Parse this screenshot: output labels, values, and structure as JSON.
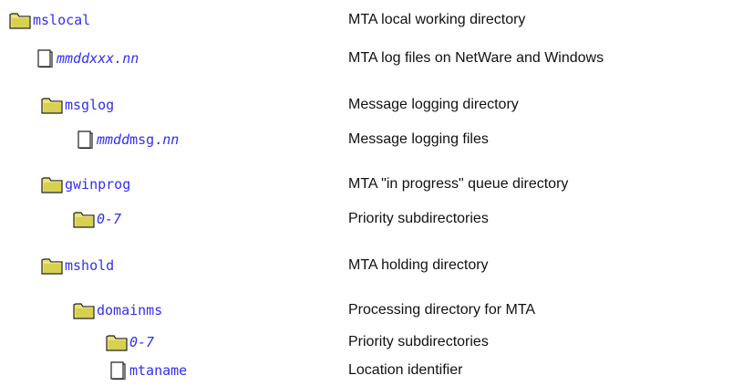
{
  "rows": [
    {
      "kind": "folder",
      "name_parts": [
        {
          "text": "mslocal",
          "italic": false
        }
      ],
      "desc": "MTA local working directory"
    },
    {
      "kind": "file",
      "name_parts": [
        {
          "text": "mmddxxx.nn",
          "italic": true
        }
      ],
      "desc": "MTA log files on NetWare and Windows"
    },
    {
      "kind": "folder",
      "name_parts": [
        {
          "text": "msglog",
          "italic": false
        }
      ],
      "desc": "Message logging directory"
    },
    {
      "kind": "file",
      "name_parts": [
        {
          "text": "mmdd",
          "italic": true
        },
        {
          "text": "msg.",
          "italic": false
        },
        {
          "text": "nn",
          "italic": true
        }
      ],
      "desc": "Message logging files"
    },
    {
      "kind": "folder",
      "name_parts": [
        {
          "text": "gwinprog",
          "italic": false
        }
      ],
      "desc": "MTA \"in progress\" queue directory"
    },
    {
      "kind": "folder",
      "name_parts": [
        {
          "text": "0-7",
          "italic": true
        }
      ],
      "desc": "Priority subdirectories"
    },
    {
      "kind": "folder",
      "name_parts": [
        {
          "text": "mshold",
          "italic": false
        }
      ],
      "desc": "MTA holding directory"
    },
    {
      "kind": "folder",
      "name_parts": [
        {
          "text": "domainms",
          "italic": false
        }
      ],
      "desc": "Processing directory for MTA"
    },
    {
      "kind": "folder",
      "name_parts": [
        {
          "text": "0-7",
          "italic": true
        }
      ],
      "desc": "Priority subdirectories"
    },
    {
      "kind": "file",
      "name_parts": [
        {
          "text": "mtaname",
          "italic": false
        }
      ],
      "desc": "Location identifier"
    }
  ],
  "icons": {
    "folder": "folder-icon",
    "file": "file-icon"
  },
  "colors": {
    "link": "#3030f0",
    "text": "#111111",
    "folder_fill": "#e8e070",
    "folder_shadow": "#b8b030"
  }
}
